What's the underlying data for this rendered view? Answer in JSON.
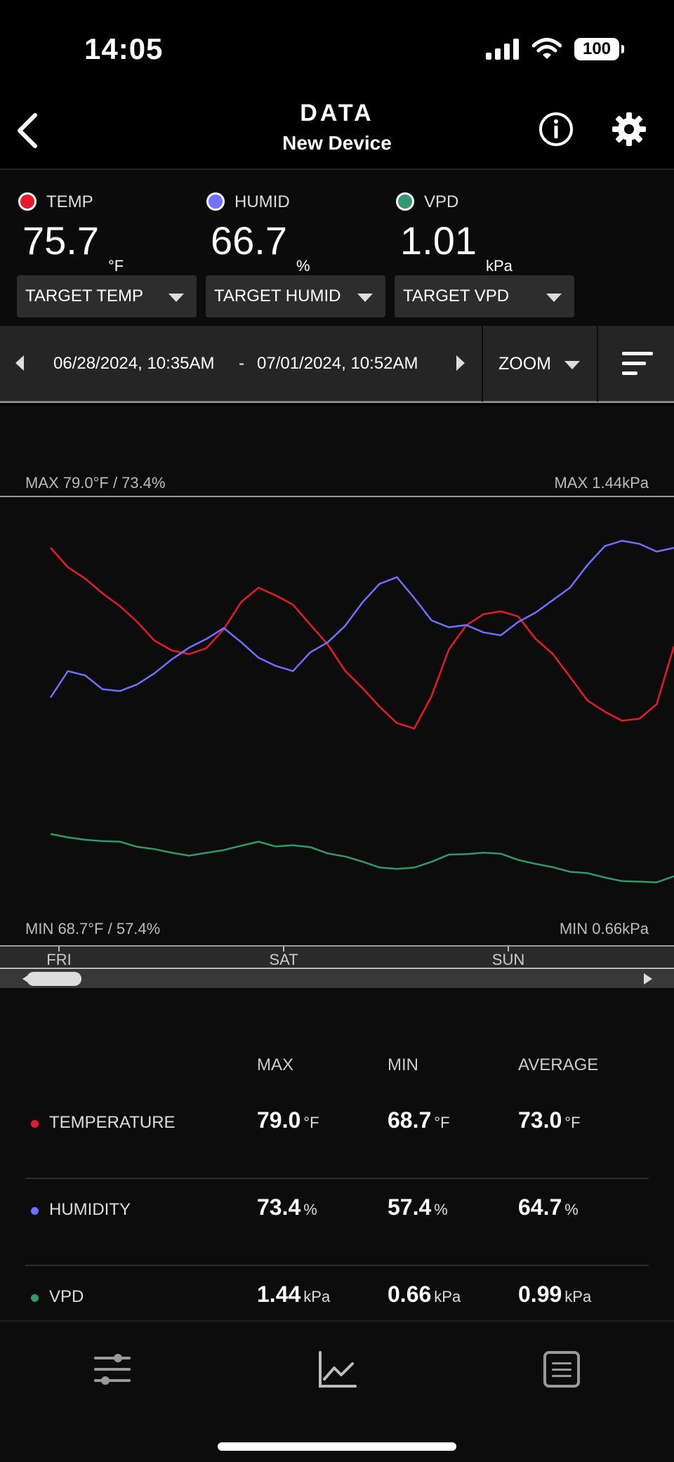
{
  "status": {
    "time": "14:05",
    "battery": "100"
  },
  "nav": {
    "title": "DATA",
    "subtitle": "New Device"
  },
  "readings": [
    {
      "label": "TEMP",
      "value": "75.7",
      "unit": "°F",
      "color": "#e8192c"
    },
    {
      "label": "HUMID",
      "value": "66.7",
      "unit": "%",
      "color": "#7070ff"
    },
    {
      "label": "VPD",
      "value": "1.01",
      "unit": "kPa",
      "color": "#2e9a6e"
    }
  ],
  "targets": [
    "TARGET TEMP",
    "TARGET HUMID",
    "TARGET VPD"
  ],
  "range": {
    "start": "06/28/2024, 10:35AM",
    "separator": "-",
    "end": "07/01/2024, 10:52AM",
    "zoom_label": "ZOOM"
  },
  "chart": {
    "max_left": "MAX 79.0°F / 73.4%",
    "max_right": "MAX 1.44kPa",
    "min_left": "MIN 68.7°F / 57.4%",
    "min_right": "MIN 0.66kPa",
    "day_labels": [
      "FRI",
      "SAT",
      "SUN"
    ]
  },
  "chart_data": {
    "type": "line",
    "x": [
      0,
      2,
      4,
      6,
      8,
      10,
      12,
      14,
      16,
      18,
      20,
      22,
      24,
      26,
      28,
      30,
      32,
      34,
      36,
      38,
      40,
      42,
      44,
      46,
      48,
      50,
      52,
      54,
      56,
      58,
      60,
      62,
      64,
      66,
      68,
      70,
      72
    ],
    "series": [
      {
        "color": "#e8192c",
        "values": [
          78.7,
          77.7,
          77.0,
          76.3,
          75.6,
          74.7,
          73.8,
          73.2,
          73.0,
          73.4,
          74.3,
          75.8,
          76.6,
          76.1,
          75.7,
          74.6,
          73.5,
          72.2,
          71.2,
          70.2,
          69.4,
          69.0,
          70.8,
          73.3,
          74.5,
          75.2,
          75.3,
          75.0,
          73.9,
          73.0,
          71.8,
          70.6,
          69.9,
          69.5,
          69.6,
          70.3,
          73.5
        ]
      },
      {
        "color": "#7070ff",
        "values": [
          60.6,
          62.7,
          62.3,
          61.3,
          61.0,
          61.6,
          62.6,
          63.6,
          64.7,
          65.4,
          66.2,
          65.2,
          63.8,
          63.1,
          62.8,
          64.2,
          65.1,
          66.5,
          68.3,
          70.0,
          70.5,
          68.7,
          67.0,
          66.3,
          66.5,
          66.0,
          65.6,
          66.8,
          67.6,
          68.5,
          69.7,
          71.5,
          73.0,
          73.6,
          73.2,
          72.6,
          73.0
        ]
      },
      {
        "color": "#2e9a6e",
        "values": [
          1.12,
          1.07,
          1.06,
          1.05,
          1.03,
          1.0,
          0.97,
          0.93,
          0.92,
          0.93,
          0.96,
          1.01,
          1.03,
          1.0,
          1.01,
          0.98,
          0.94,
          0.9,
          0.85,
          0.81,
          0.78,
          0.8,
          0.86,
          0.91,
          0.93,
          0.94,
          0.92,
          0.88,
          0.83,
          0.8,
          0.77,
          0.74,
          0.71,
          0.68,
          0.66,
          0.67,
          0.72
        ]
      }
    ],
    "ylim_temp": [
      68.7,
      79.0
    ],
    "ylim_humid": [
      57.4,
      73.4
    ],
    "ylim_vpd": [
      0.66,
      1.44
    ]
  },
  "stats": {
    "headers": [
      "MAX",
      "MIN",
      "AVERAGE"
    ],
    "rows": [
      {
        "name": "TEMPERATURE",
        "color": "#e8192c",
        "max": "79.0",
        "min": "68.7",
        "avg": "73.0",
        "unit": "°F"
      },
      {
        "name": "HUMIDITY",
        "color": "#7070ff",
        "max": "73.4",
        "min": "57.4",
        "avg": "64.7",
        "unit": "%"
      },
      {
        "name": "VPD",
        "color": "#2e9a6e",
        "max": "1.44",
        "min": "0.66",
        "avg": "0.99",
        "unit": "kPa"
      }
    ]
  },
  "tabs": [
    "sliders-icon",
    "chart-icon",
    "list-icon"
  ]
}
